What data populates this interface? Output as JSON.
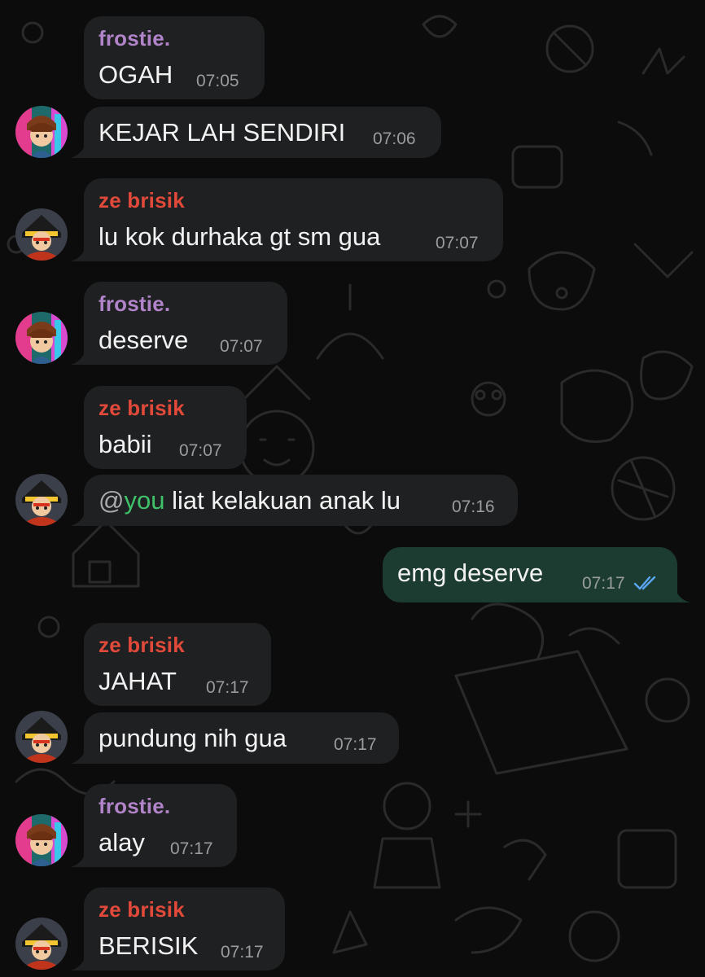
{
  "colors": {
    "frostie": "#b183c8",
    "ze_brisik": "#e1493a",
    "mention": "#3ec168",
    "read_ticks": "#5aa6f4",
    "incoming_bubble": "#1f2021",
    "outgoing_bubble": "#1d3c31"
  },
  "messages": [
    {
      "sender": "frostie.",
      "text": "OGAH",
      "time": "07:05"
    },
    {
      "text": "KEJAR LAH SENDIRI",
      "time": "07:06"
    },
    {
      "sender": "ze brisik",
      "text": "lu kok durhaka gt sm gua",
      "time": "07:07"
    },
    {
      "sender": "frostie.",
      "text": "deserve",
      "time": "07:07"
    },
    {
      "sender": "ze brisik",
      "text": "babii",
      "time": "07:07"
    },
    {
      "mention_at": "@",
      "mention_name": "you",
      "text": " liat kelakuan anak lu",
      "time": "07:16"
    },
    {
      "text": "emg deserve",
      "time": "07:17",
      "status_icon": "double-check-icon"
    },
    {
      "sender": "ze brisik",
      "text": "JAHAT",
      "time": "07:17"
    },
    {
      "text": "pundung nih gua",
      "time": "07:17"
    },
    {
      "sender": "frostie.",
      "text": "alay",
      "time": "07:17"
    },
    {
      "sender": "ze brisik",
      "text": "BERISIK",
      "time": "07:17"
    }
  ]
}
